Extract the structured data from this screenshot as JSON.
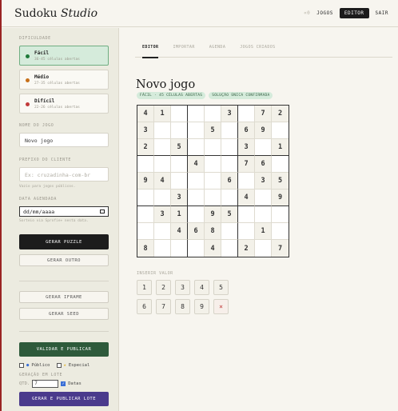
{
  "brand": {
    "name": "Sudoku",
    "suffix": "Studio"
  },
  "nav": {
    "count": "«0",
    "games": "JOGOS",
    "editor": "EDITOR",
    "logout": "SAIR"
  },
  "sidebar": {
    "difficulty_label": "DIFICULDADE",
    "difficulties": [
      {
        "name": "Fácil",
        "sub": "36-45 células abertas",
        "dot": "#1f7a3a",
        "active": true
      },
      {
        "name": "Médio",
        "sub": "27-35 células abertas",
        "dot": "#c7701a",
        "active": false
      },
      {
        "name": "Difícil",
        "sub": "22-26 células abertas",
        "dot": "#c23b3b",
        "active": false
      }
    ],
    "game_name_label": "NOME DO JOGO",
    "game_name_value": "Novo jogo",
    "client_prefix_label": "PREFIXO DO CLIENTE",
    "client_prefix_placeholder": "Ex: cruzadinha-com-br",
    "client_prefix_hint": "Vazio para jogos públicos.",
    "date_label": "DATA AGENDADA",
    "date_value": "dd/mm/aaaa",
    "date_hint": "Sorteio via Sprofie+ nesta data.",
    "generate_puzzle": "GERAR PUZZLE",
    "generate_other": "GERAR OUTRO",
    "generate_iframe": "GERAR IFRAME",
    "generate_seed": "GERAR SEED",
    "validate_publish": "VALIDAR E PUBLICAR",
    "public_label": "Público",
    "special_label": "Especial",
    "batch_label": "GERAÇÃO EM LOTE",
    "qty_label": "QTD.",
    "qty_value": "7",
    "dates_label": "Datas",
    "batch_publish": "GERAR E PUBLICAR LOTE",
    "accent_green": "#2e5a3b",
    "accent_purple": "#4a3a8c"
  },
  "main": {
    "tabs": [
      "EDITOR",
      "IMPORTAR",
      "AGENDA",
      "JOGOS CRIADOS"
    ],
    "active_tab": 0,
    "title": "Novo jogo",
    "badges": [
      "FÁCIL · 45 CÉLULAS ABERTAS",
      "SOLUÇÃO ÚNICA CONFIRMADA"
    ],
    "grid": [
      [
        "4",
        "1",
        "",
        "",
        "",
        "3",
        "",
        "7",
        "2"
      ],
      [
        "3",
        "",
        "",
        "",
        "5",
        "",
        "6",
        "9",
        ""
      ],
      [
        "2",
        "",
        "5",
        "",
        "",
        "",
        "3",
        "",
        "1"
      ],
      [
        "",
        "",
        "",
        "4",
        "",
        "",
        "7",
        "6",
        ""
      ],
      [
        "9",
        "4",
        "",
        "",
        "",
        "6",
        "",
        "3",
        "5"
      ],
      [
        "",
        "",
        "3",
        "",
        "",
        "",
        "4",
        "",
        "9"
      ],
      [
        "",
        "3",
        "1",
        "",
        "9",
        "5",
        "",
        "",
        ""
      ],
      [
        "",
        "",
        "4",
        "6",
        "8",
        "",
        "",
        "1",
        ""
      ],
      [
        "8",
        "",
        "",
        "",
        "4",
        "",
        "2",
        "",
        "7"
      ]
    ],
    "input_label": "INSERIR VALOR",
    "keys_row1": [
      "1",
      "2",
      "3",
      "4",
      "5"
    ],
    "keys_row2": [
      "6",
      "7",
      "8",
      "9",
      "×"
    ]
  }
}
